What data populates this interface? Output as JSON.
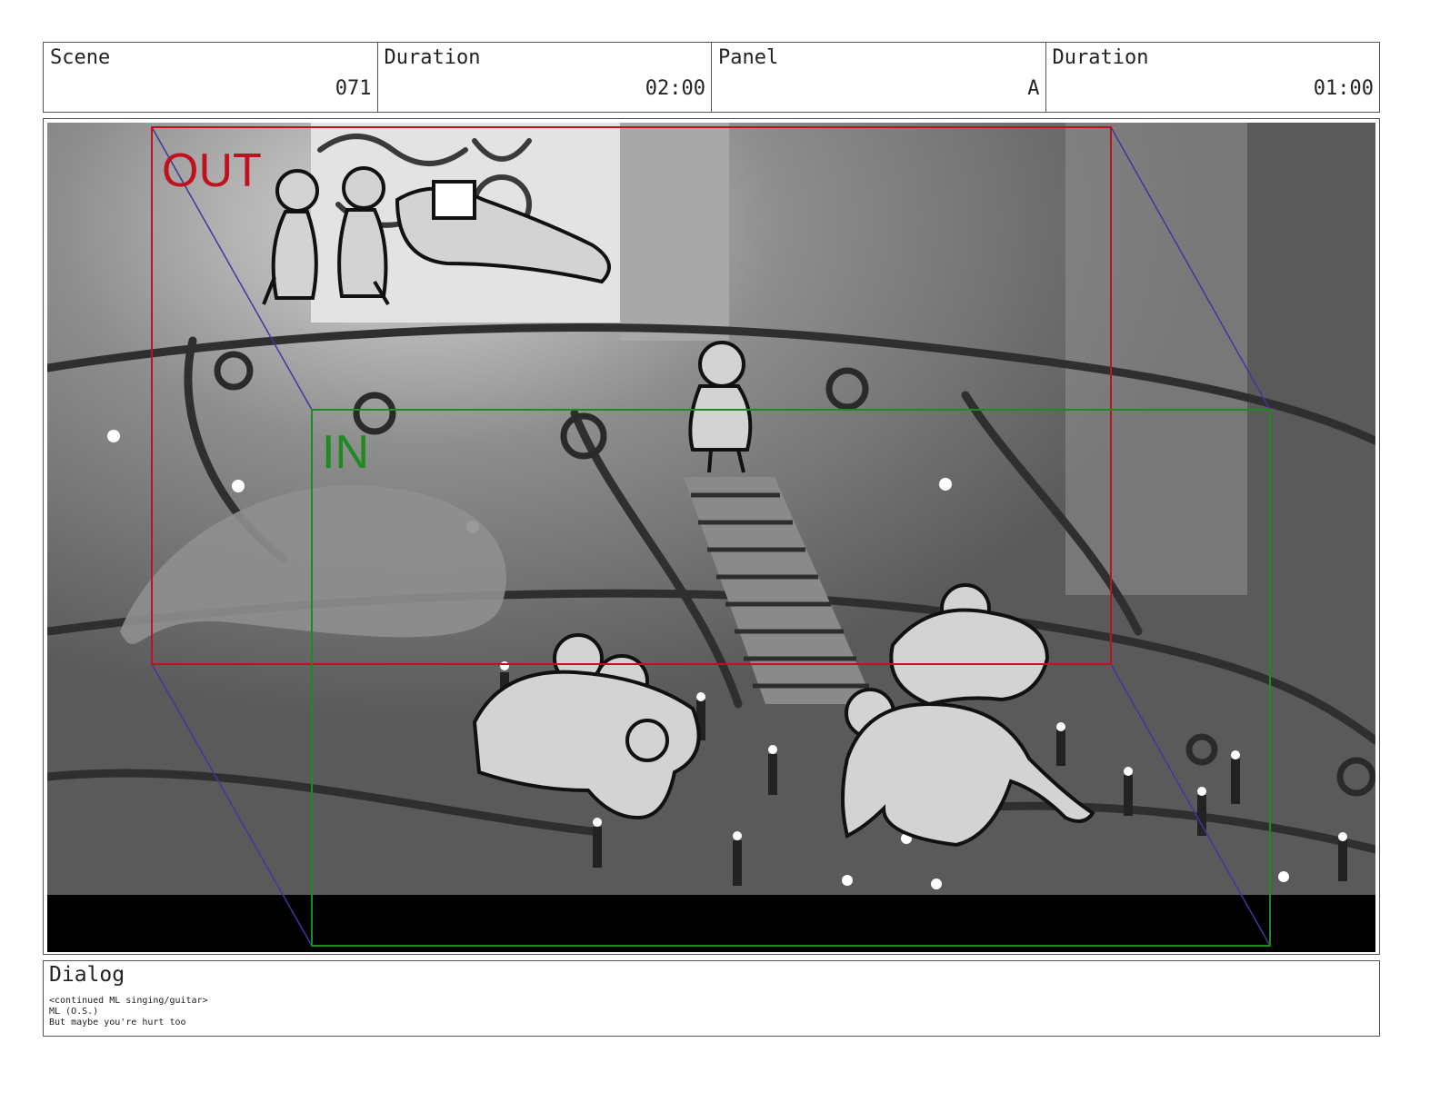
{
  "header": {
    "scene_label": "Scene",
    "scene_value": "071",
    "scene_duration_label": "Duration",
    "scene_duration_value": "02:00",
    "panel_label": "Panel",
    "panel_value": "A",
    "panel_duration_label": "Duration",
    "panel_duration_value": "01:00"
  },
  "panel": {
    "out_label": "OUT",
    "in_label": "IN",
    "out_color": "#c0111f",
    "in_color": "#1f8a1f",
    "guide_color": "#3a3aa8"
  },
  "dialog": {
    "label": "Dialog",
    "lines": [
      "<continued ML singing/guitar>",
      "ML (O.S.)",
      "But maybe you're hurt too"
    ]
  }
}
